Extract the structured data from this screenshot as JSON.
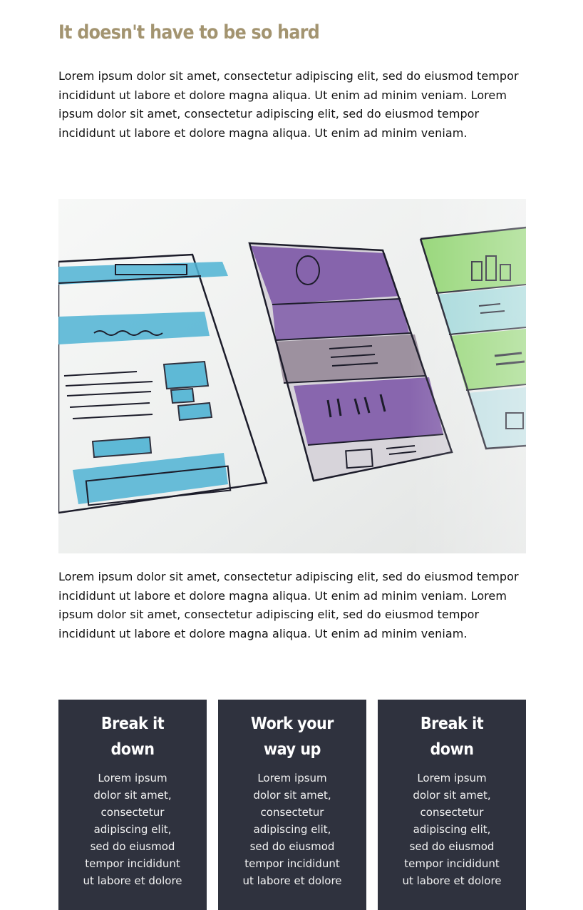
{
  "article": {
    "title": "It doesn't have to be so hard",
    "intro": "Lorem ipsum dolor sit amet, consectetur adipiscing elit, sed do eiusmod tempor incididunt ut labore et dolore magna aliqua. Ut enim ad minim veniam. Lorem ipsum dolor sit amet, consectetur adipiscing elit, sed do eiusmod tempor incididunt ut labore et dolore magna aliqua. Ut enim ad minim veniam.",
    "body": "Lorem ipsum dolor sit amet, consectetur adipiscing elit, sed do eiusmod tempor incididunt ut labore et dolore magna aliqua. Ut enim ad minim veniam. Lorem ipsum dolor sit amet, consectetur adipiscing elit, sed do eiusmod tempor incididunt ut labore et dolore magna aliqua. Ut enim ad minim veniam."
  },
  "hero_image": {
    "icon": "wireframe-sketch-image"
  },
  "cards": [
    {
      "title": "Break it down",
      "text": "Lorem ipsum dolor sit amet, consectetur adipiscing elit, sed do eiusmod tempor incididunt ut labore et dolore"
    },
    {
      "title": "Work your way up",
      "text": "Lorem ipsum dolor sit amet, consectetur adipiscing elit, sed do eiusmod tempor incididunt ut labore et dolore"
    },
    {
      "title": "Break it down",
      "text": "Lorem ipsum dolor sit amet, consectetur adipiscing elit, sed do eiusmod tempor incididunt ut labore et dolore"
    }
  ],
  "colors": {
    "heading": "#a39470",
    "card_background": "#2f323e",
    "text": "#111111",
    "sketch_blue": "#4fb3d4",
    "sketch_purple": "#7f5aa8",
    "sketch_green": "#8cd36a"
  }
}
